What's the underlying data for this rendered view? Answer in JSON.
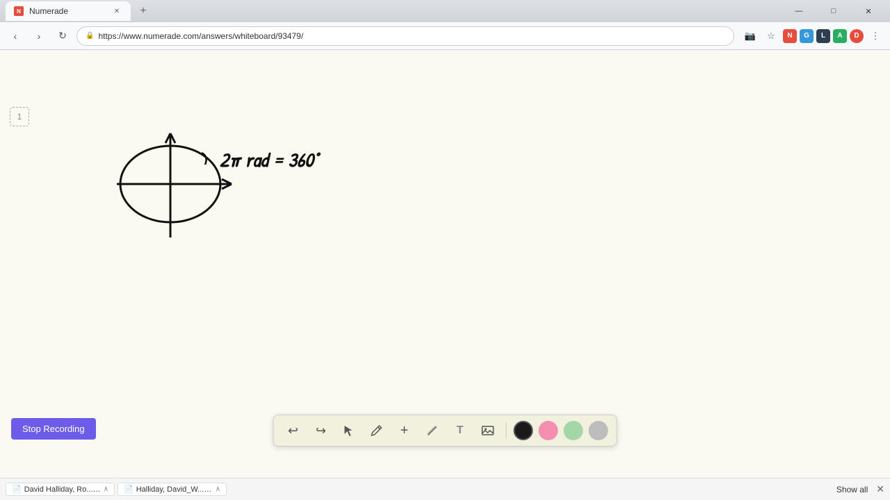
{
  "browser": {
    "tab_label": "Numerade",
    "tab_url": "https://www.numerade.com/answers/whiteboard/93479/",
    "window_controls": {
      "minimize": "—",
      "maximize": "□",
      "close": "✕"
    }
  },
  "address_bar": {
    "url": "https://www.numerade.com/answers/whiteboard/93479/",
    "lock_icon": "🔒"
  },
  "page_indicator": {
    "number": "1"
  },
  "toolbar": {
    "undo_label": "↩",
    "redo_label": "↪",
    "select_label": "↖",
    "pen_label": "✏",
    "add_label": "+",
    "highlighter_label": "╱",
    "text_label": "T",
    "image_label": "🖼",
    "colors": [
      {
        "name": "black",
        "value": "#1a1a1a"
      },
      {
        "name": "pink",
        "value": "#f48fb1"
      },
      {
        "name": "green",
        "value": "#a5d6a7"
      },
      {
        "name": "gray",
        "value": "#bdbdbd"
      }
    ]
  },
  "stop_recording": {
    "label": "Stop Recording"
  },
  "status_bar": {
    "pdf1_name": "David Halliday, Ro....pdf",
    "pdf2_name": "Halliday, David_W....pdf",
    "show_all": "Show all"
  },
  "drawing": {
    "equation": "2π rad = 360°"
  }
}
